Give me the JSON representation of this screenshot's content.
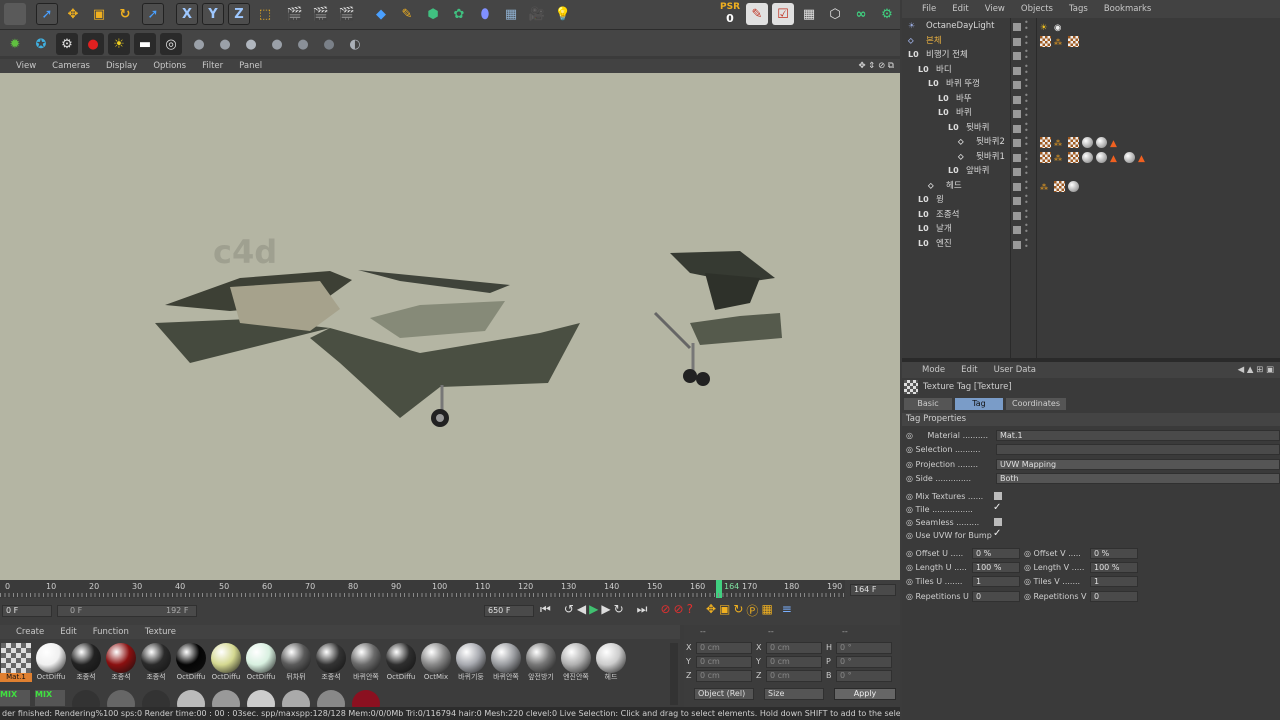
{
  "toolbar": {
    "axis_x": "X",
    "axis_y": "Y",
    "axis_z": "Z",
    "psr_label": "PSR",
    "psr_value": "0"
  },
  "viewport": {
    "menu": [
      "View",
      "Cameras",
      "Display",
      "Options",
      "Filter",
      "Panel"
    ],
    "watermark": "c4d"
  },
  "timeline": {
    "ticks": [
      "0",
      "10",
      "20",
      "30",
      "40",
      "50",
      "60",
      "70",
      "80",
      "90",
      "100",
      "110",
      "120",
      "130",
      "140",
      "150",
      "160",
      "164",
      "170",
      "180",
      "190"
    ],
    "current_frame_display": "164 F",
    "start_field": "0 F",
    "range_start": "0 F",
    "range_end": "192 F",
    "end_field": "650 F"
  },
  "materials": {
    "menu": [
      "Create",
      "Edit",
      "Function",
      "Texture"
    ],
    "row1": [
      {
        "label": "Mat.1",
        "color": "#e08030",
        "selected": true
      },
      {
        "label": "OctDiffu",
        "color": "#f0f0f0"
      },
      {
        "label": "조종석",
        "color": "#222222"
      },
      {
        "label": "조종석",
        "color": "#8b1010"
      },
      {
        "label": "조종석",
        "color": "#2a2a2a"
      },
      {
        "label": "OctDiffu",
        "color": "#050505"
      },
      {
        "label": "OctDiffu",
        "color": "#d4d890"
      },
      {
        "label": "OctDiffu",
        "color": "#d8f0e0"
      },
      {
        "label": "뒤차뒤",
        "color": "#5a5a5a"
      },
      {
        "label": "조종석",
        "color": "#333333"
      },
      {
        "label": "바퀴안쪽",
        "color": "#6a6a6a"
      },
      {
        "label": "OctDiffu",
        "color": "#2e2e2e"
      },
      {
        "label": "OctMix",
        "color": "#888888"
      },
      {
        "label": "바퀴기둥",
        "color": "#a8aab0"
      },
      {
        "label": "바퀴안쪽",
        "color": "#9a9ca0"
      },
      {
        "label": "앞전방기",
        "color": "#777777"
      },
      {
        "label": "엔진안쪽",
        "color": "#b0b0b0"
      },
      {
        "label": "헤드",
        "color": "#cccccc"
      }
    ],
    "mix_label": "MIX"
  },
  "coords": {
    "header": [
      "--",
      "--",
      "--"
    ],
    "rows": [
      {
        "a": "X",
        "av": "0 cm",
        "b": "X",
        "bv": "0 cm",
        "c": "H",
        "cv": "0 °"
      },
      {
        "a": "Y",
        "av": "0 cm",
        "b": "Y",
        "bv": "0 cm",
        "c": "P",
        "cv": "0 °"
      },
      {
        "a": "Z",
        "av": "0 cm",
        "b": "Z",
        "bv": "0 cm",
        "c": "B",
        "cv": "0 °"
      }
    ],
    "mode_select": "Object (Rel)",
    "size_select": "Size",
    "apply": "Apply"
  },
  "status": "der finished: Rendering%100 sps:0 Render time:00 : 00 : 03sec. spp/maxspp:128/128 Mem:0/0/0Mb Tri:0/116794 hair:0 Mesh:220 clevel:0     Live Selection: Click and drag to select elements. Hold down SHIFT to add to the selection, CTRL to rem",
  "objects": {
    "menu": [
      "File",
      "Edit",
      "View",
      "Objects",
      "Tags",
      "Bookmarks"
    ],
    "rows": [
      {
        "label": "OctaneDayLight",
        "indent": 0,
        "color": "#d8d8d8"
      },
      {
        "label": "본체",
        "indent": 0,
        "color": "#e8b040"
      },
      {
        "label": "비행기 전체",
        "indent": 0,
        "color": "#d8d8d8"
      },
      {
        "label": "바디",
        "indent": 1,
        "color": "#d8d8d8"
      },
      {
        "label": "바퀴 뚜껑",
        "indent": 2,
        "color": "#d8d8d8"
      },
      {
        "label": "바뚜",
        "indent": 3,
        "color": "#d8d8d8"
      },
      {
        "label": "바퀴",
        "indent": 3,
        "color": "#d8d8d8"
      },
      {
        "label": "뒷바퀴",
        "indent": 4,
        "color": "#d8d8d8"
      },
      {
        "label": "뒷바퀴2",
        "indent": 5,
        "color": "#d8d8d8"
      },
      {
        "label": "뒷바퀴1",
        "indent": 5,
        "color": "#d8d8d8"
      },
      {
        "label": "앞바퀴",
        "indent": 4,
        "color": "#d8d8d8"
      },
      {
        "label": "헤드",
        "indent": 2,
        "color": "#d8d8d8"
      },
      {
        "label": "윙",
        "indent": 1,
        "color": "#d8d8d8"
      },
      {
        "label": "조종석",
        "indent": 1,
        "color": "#d8d8d8"
      },
      {
        "label": "날개",
        "indent": 1,
        "color": "#d8d8d8"
      },
      {
        "label": "엔진",
        "indent": 1,
        "color": "#d8d8d8"
      }
    ]
  },
  "attributes": {
    "menu": [
      "Mode",
      "Edit",
      "User Data"
    ],
    "title": "Texture Tag [Texture]",
    "tabs": [
      "Basic",
      "Tag",
      "Coordinates"
    ],
    "section": "Tag Properties",
    "material_label": "Material",
    "material_value": "Mat.1",
    "selection_label": "Selection",
    "projection_label": "Projection",
    "projection_value": "UVW Mapping",
    "side_label": "Side",
    "side_value": "Both",
    "mix_textures": "Mix Textures",
    "tile": "Tile",
    "seamless": "Seamless",
    "use_uvw": "Use UVW for Bump",
    "offset_u": "Offset U",
    "offset_u_val": "0 %",
    "offset_v": "Offset V",
    "offset_v_val": "0 %",
    "length_u": "Length U",
    "length_u_val": "100 %",
    "length_v": "Length V",
    "length_v_val": "100 %",
    "tiles_u": "Tiles U",
    "tiles_u_val": "1",
    "tiles_v": "Tiles V",
    "tiles_v_val": "1",
    "rep_u": "Repetitions U",
    "rep_u_val": "0",
    "rep_v": "Repetitions V",
    "rep_v_val": "0"
  }
}
